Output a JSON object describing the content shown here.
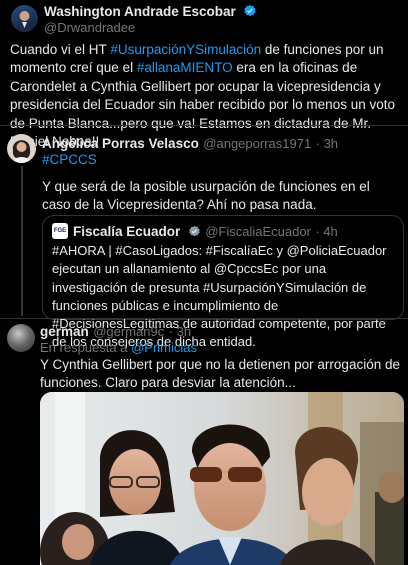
{
  "main_tweet": {
    "display_name": "Washington Andrade Escobar",
    "handle": "@Drwandradee",
    "text_parts": [
      {
        "t": "Cuando vi el HT ",
        "hl": false
      },
      {
        "t": "#UsurpaciónYSimulación",
        "hl": true
      },
      {
        "t": " de funciones por un momento creí que el ",
        "hl": false
      },
      {
        "t": "#allanaMIENTO",
        "hl": true
      },
      {
        "t": " era en la oficinas de Carondelet a Cynthia Gellibert por ocupar la vicepresidencia y presidencia del Ecuador sin haber recibido por lo menos un voto de Punta Blanca...pero que va! Estamos en dictadura de Mr. Daniel Noboa!!",
        "hl": false
      }
    ]
  },
  "reply1": {
    "display_name": "Angélica Porras Velasco",
    "handle": "@angeporras1971",
    "time": "· 3h",
    "hashtag": "#CPCCS",
    "text": "Y que será de la posible usurpación de funciones en el caso de la Vicepresidenta? Ahí no pasa nada.",
    "quote": {
      "avatar_text": "FGE",
      "display_name": "Fiscalía Ecuador",
      "handle": "@FiscaliaEcuador",
      "time": "· 4h",
      "text": "#AHORA | #CasoLigados: #FiscalíaEc y @PoliciaEcuador ejecutan un allanamiento al @CpccsEc por una investigación de presunta #UsurpaciónYSimulación de funciones públicas e incumplimiento de #DecisionesLegítimas de autoridad competente, por parte de los consejeros de dicha entidad."
    }
  },
  "reply2": {
    "display_name": "german",
    "handle": "@german9c",
    "time": "· 3h",
    "replying_prefix": "En respuesta a",
    "replying_to": "@Primicias",
    "text": "Y Cynthia Gellibert por que no la detienen por arrogación de funciones. Claro para desviar la atención..."
  },
  "colors": {
    "background": "#000000",
    "text": "#e7e9ea",
    "muted": "#71767b",
    "link": "#1d9bf0",
    "border": "#2f3336"
  },
  "icons": [
    "verified-badge-icon",
    "more-options-icon"
  ]
}
